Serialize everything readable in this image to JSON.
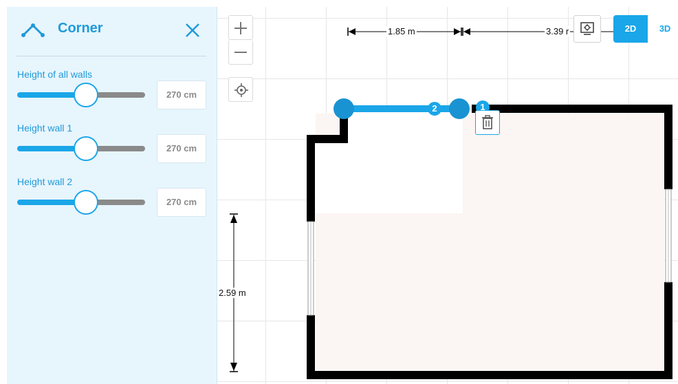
{
  "panel": {
    "title": "Corner",
    "icon": "corner-icon",
    "close_icon": "close-icon",
    "fields": [
      {
        "label": "Height of all walls",
        "value": "270 cm",
        "level": 0.54
      },
      {
        "label": "Height wall 1",
        "value": "270 cm",
        "level": 0.54
      },
      {
        "label": "Height wall 2",
        "value": "270 cm",
        "level": 0.54
      }
    ]
  },
  "toolbar": {
    "zoom_in_icon": "plus-icon",
    "zoom_out_icon": "minus-icon",
    "center_icon": "target-icon",
    "settings_icon": "display-settings-icon",
    "view_2d": "2D",
    "view_3d": "3D",
    "active_view": "2D"
  },
  "canvas": {
    "dim_top_1": "1.85 m",
    "dim_top_2": "3.39 r",
    "dim_left": "2.59 m",
    "wall_label_1": "1",
    "wall_label_2": "2",
    "delete_icon": "trash-icon"
  },
  "colors": {
    "accent": "#1aa6e8",
    "panel_bg": "#e7f5fd",
    "wall": "#000000",
    "floor": "#fbf6f3"
  }
}
